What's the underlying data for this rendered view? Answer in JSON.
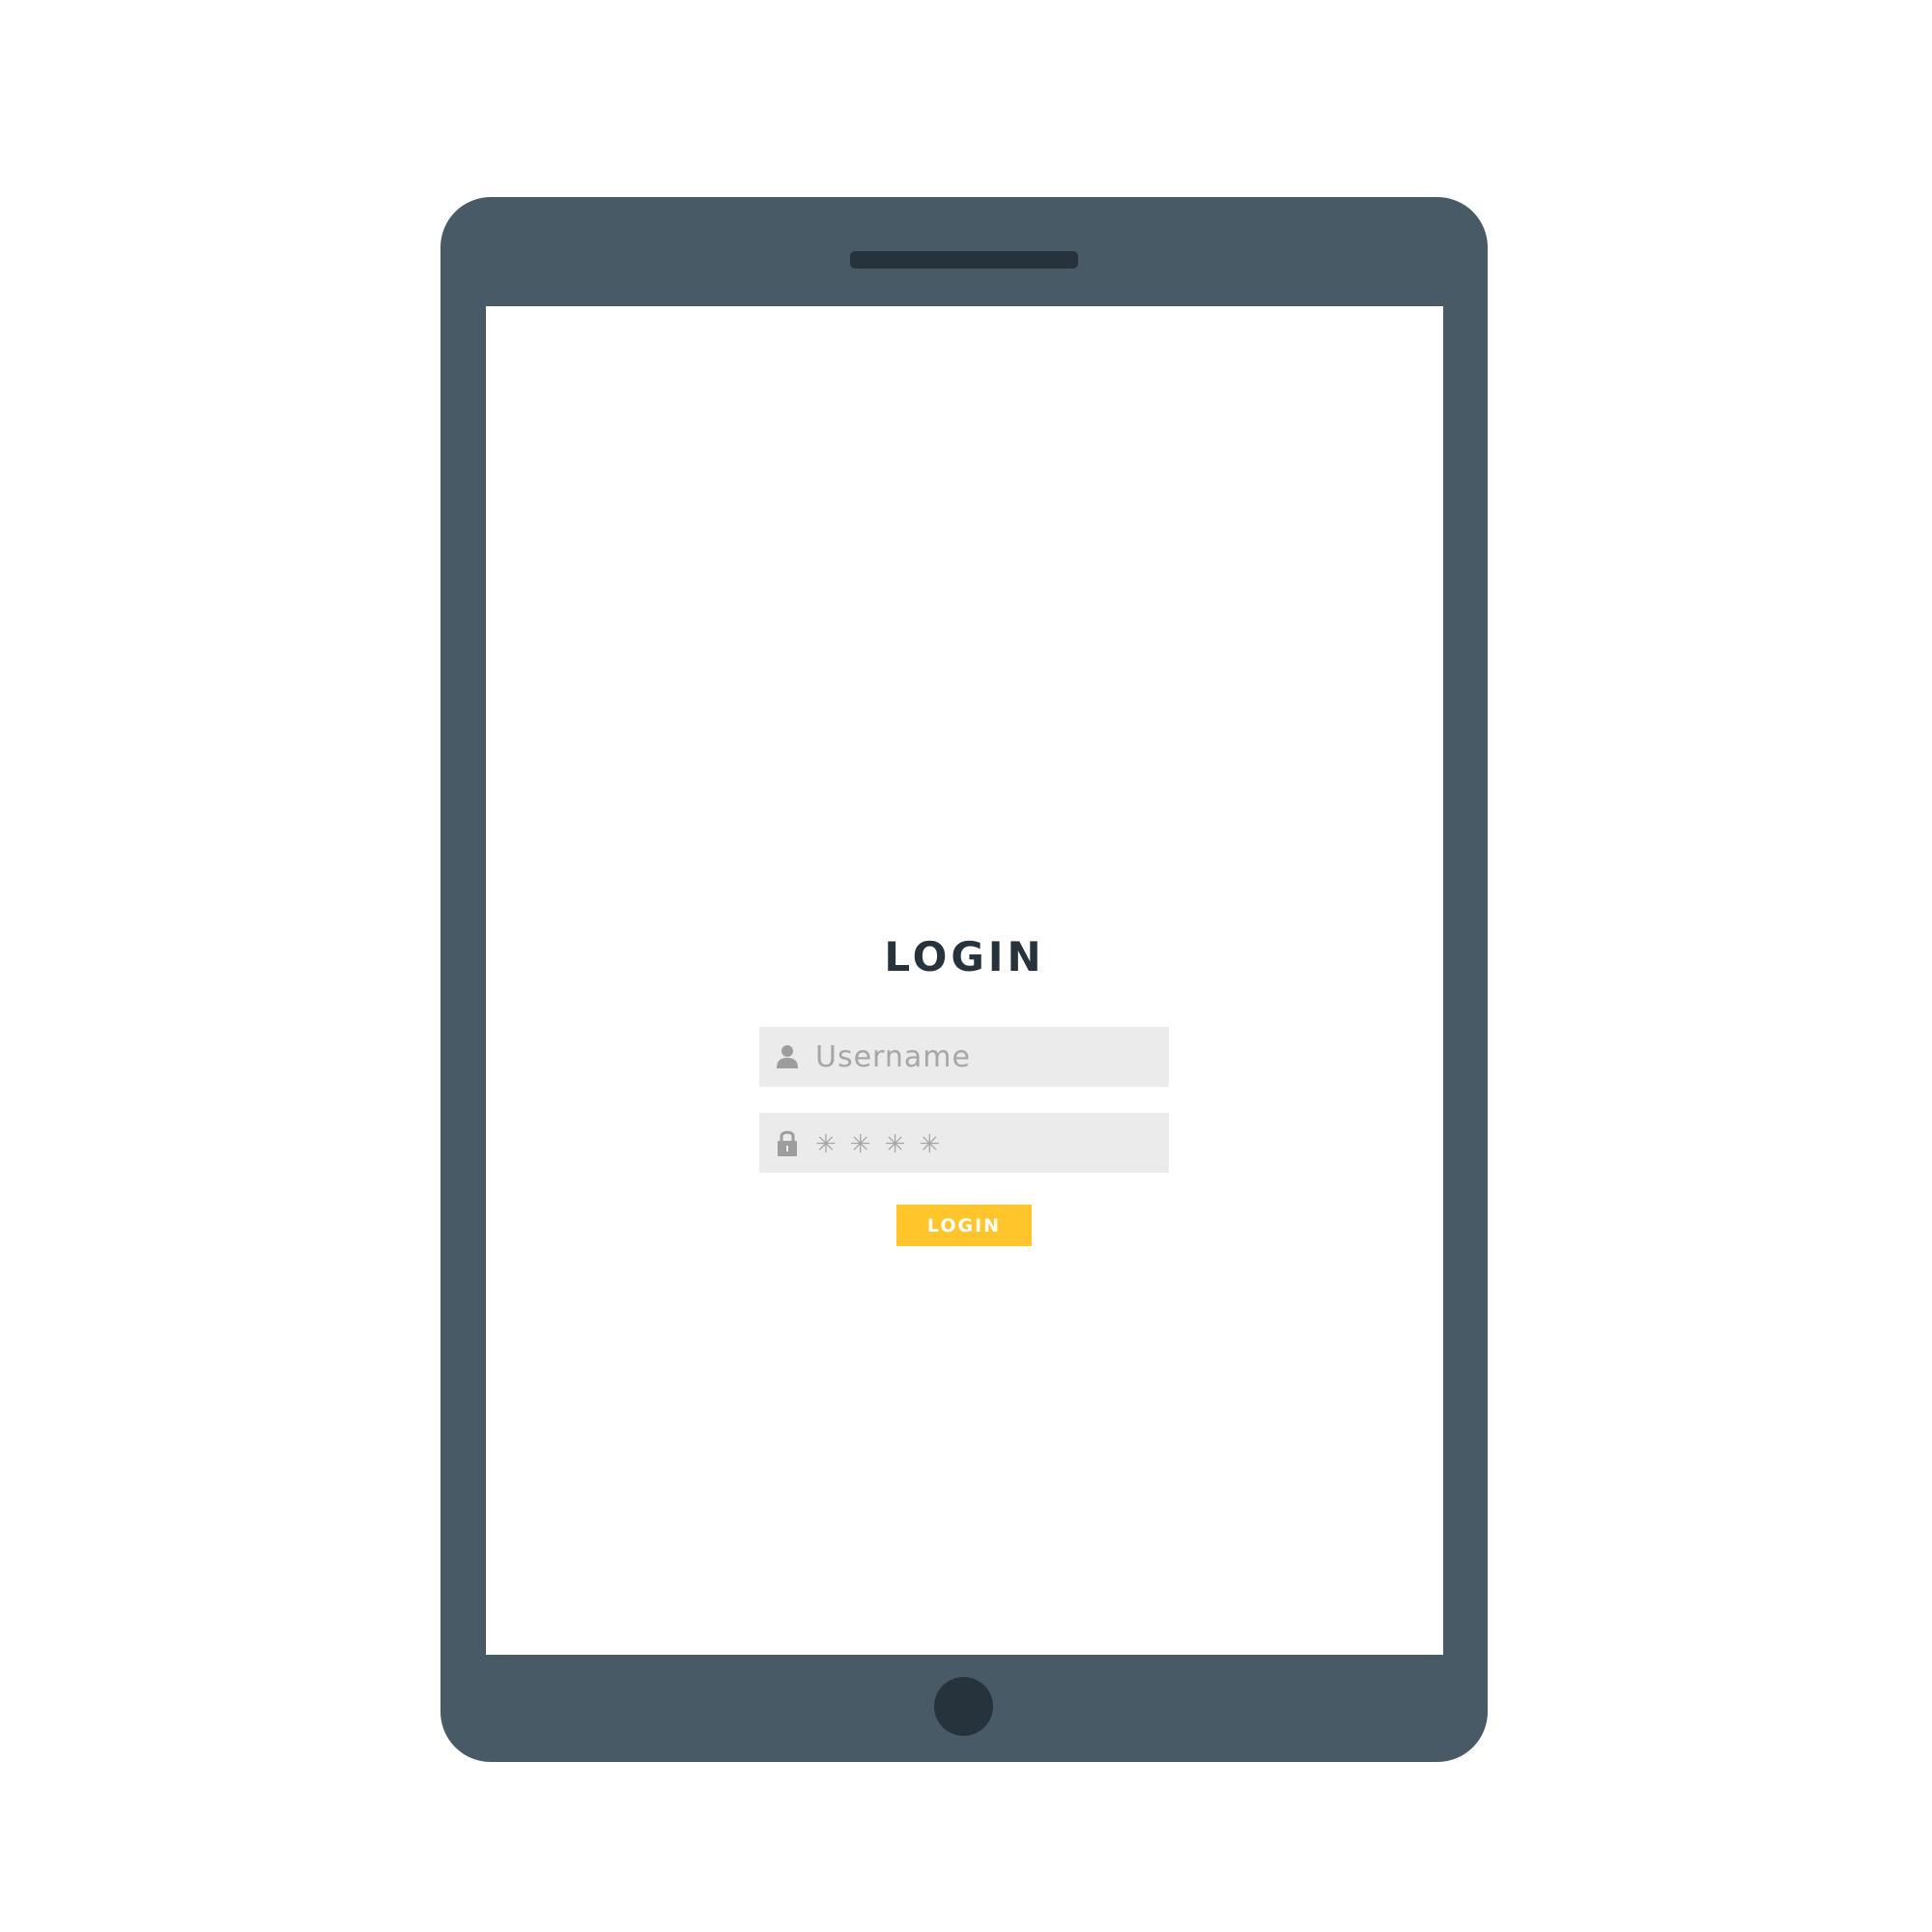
{
  "login_title": "LOGIN",
  "username_field": {
    "placeholder": "Username",
    "icon": "user-icon"
  },
  "password_field": {
    "value": "✳✳✳✳",
    "icon": "lock-icon"
  },
  "login_button": {
    "label": "LOGIN"
  },
  "colors": {
    "device_body": "#475a66",
    "device_dark": "#27333c",
    "field_background": "#ebebeb",
    "placeholder_text": "#a6a6a6",
    "button_accent": "#ffc52b"
  }
}
